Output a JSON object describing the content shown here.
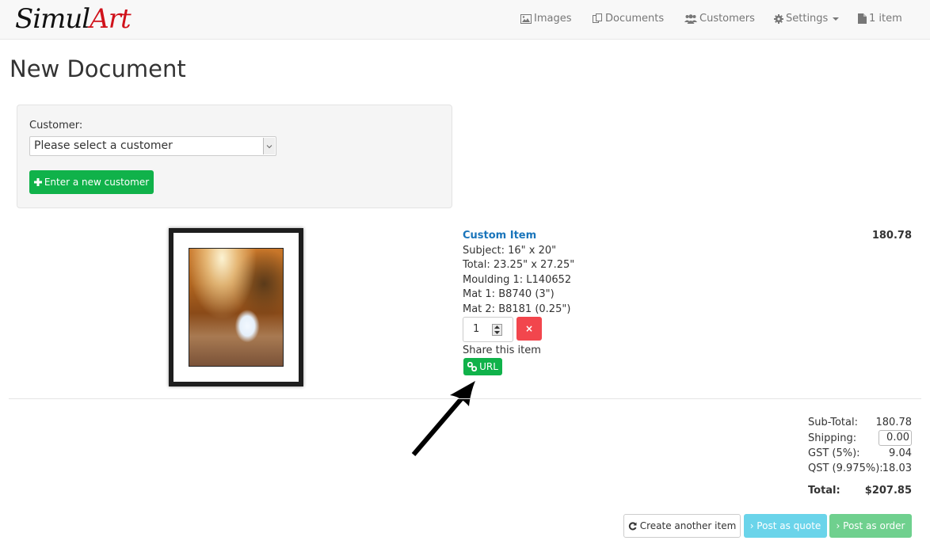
{
  "brand": {
    "part1": "Simul",
    "part2": "Art"
  },
  "nav": {
    "images": "Images",
    "documents": "Documents",
    "customers": "Customers",
    "settings": "Settings",
    "cart": "1 item"
  },
  "page": {
    "title": "New Document"
  },
  "customer": {
    "label": "Customer:",
    "select_value": "Please select a customer",
    "new_button": "Enter a new customer"
  },
  "item": {
    "title": "Custom Item",
    "price": "180.78",
    "lines": [
      "Subject: 16\" x 20\"",
      "Total: 23.25\" x 27.25\"",
      "Moulding 1: L140652",
      "Mat 1: B8740 (3\")",
      "Mat 2: B8181 (0.25\")"
    ],
    "quantity": "1",
    "remove_icon": "×",
    "share_label": "Share this item",
    "url_button": "URL"
  },
  "totals": {
    "subtotal_label": "Sub-Total:",
    "subtotal_value": "180.78",
    "shipping_label": "Shipping:",
    "shipping_value": "0.00",
    "gst_label": "GST (5%):",
    "gst_value": "9.04",
    "qst_label": "QST (9.975%):",
    "qst_value": "18.03",
    "total_label": "Total:",
    "total_value": "$207.85"
  },
  "actions": {
    "create_another": "Create another item",
    "post_quote": "› Post as quote",
    "post_order": "› Post as order"
  },
  "colors": {
    "brand_red": "#d0121b",
    "success": "#10b24a",
    "danger": "#f2464d",
    "info": "#6ad4ea",
    "link": "#1a75bb"
  }
}
